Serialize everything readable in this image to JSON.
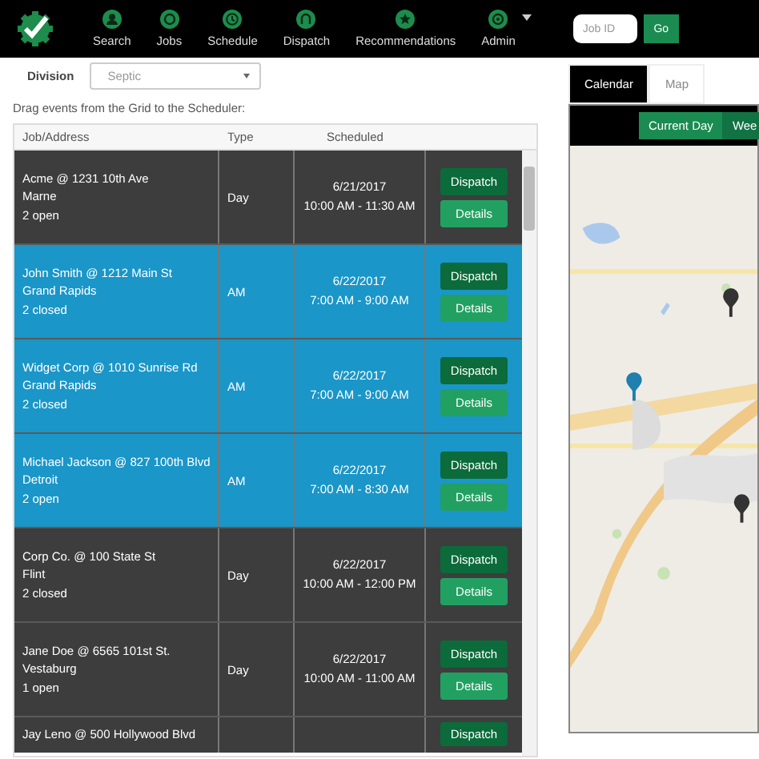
{
  "nav": {
    "items": [
      {
        "label": "Search"
      },
      {
        "label": "Jobs"
      },
      {
        "label": "Schedule"
      },
      {
        "label": "Dispatch"
      },
      {
        "label": "Recommendations"
      },
      {
        "label": "Admin"
      }
    ],
    "job_id": {
      "placeholder": "Job ID"
    },
    "go": "Go"
  },
  "division": {
    "label": "Division",
    "value": "Septic"
  },
  "hint": "Drag events from the Grid to the Scheduler:",
  "table": {
    "columns": [
      "Job/Address",
      "Type",
      "Scheduled"
    ],
    "rows": [
      {
        "job": "Acme @ 1231 10th Ave",
        "city": "Marne",
        "status": "2 open",
        "type": "Day",
        "date": "6/21/2017",
        "time": "10:00 AM - 11:30 AM",
        "color": "#3d3d3d",
        "buttons": [
          "Dispatch",
          "Details"
        ]
      },
      {
        "job": "John Smith @ 1212 Main St",
        "city": "Grand Rapids",
        "status": "2 closed",
        "type": "AM",
        "date": "6/22/2017",
        "time": "7:00 AM - 9:00 AM",
        "color": "#1a96c8",
        "buttons": [
          "Dispatch",
          "Details"
        ]
      },
      {
        "job": "Widget Corp @ 1010 Sunrise Rd",
        "city": "Grand Rapids",
        "status": "2 closed",
        "type": "AM",
        "date": "6/22/2017",
        "time": "7:00 AM - 9:00 AM",
        "color": "#1a96c8",
        "buttons": [
          "Dispatch",
          "Details"
        ]
      },
      {
        "job": "Michael Jackson @ 827 100th Blvd",
        "city": "Detroit",
        "status": "2 open",
        "type": "AM",
        "date": "6/22/2017",
        "time": "7:00 AM - 8:30 AM",
        "color": "#1a96c8",
        "buttons": [
          "Dispatch",
          "Details"
        ]
      },
      {
        "job": "Corp Co. @ 100 State St",
        "city": "Flint",
        "status": "2 closed",
        "type": "Day",
        "date": "6/22/2017",
        "time": "10:00 AM - 12:00 PM",
        "color": "#3d3d3d",
        "buttons": [
          "Dispatch",
          "Details"
        ]
      },
      {
        "job": "Jane Doe @ 6565 101st St.",
        "city": "Vestaburg",
        "status": "1 open",
        "type": "Day",
        "date": "6/22/2017",
        "time": "10:00 AM - 11:00 AM",
        "color": "#3d3d3d",
        "buttons": [
          "Dispatch",
          "Details"
        ]
      },
      {
        "job": "Jay Leno @ 500 Hollywood Blvd",
        "color": "#3d3d3d",
        "buttons": [
          "Dispatch"
        ]
      }
    ]
  },
  "panel": {
    "tabs": [
      {
        "label": "Calendar",
        "selected": true
      },
      {
        "label": "Map",
        "selected": false
      }
    ],
    "views": [
      "Current Day",
      "Wee"
    ]
  }
}
